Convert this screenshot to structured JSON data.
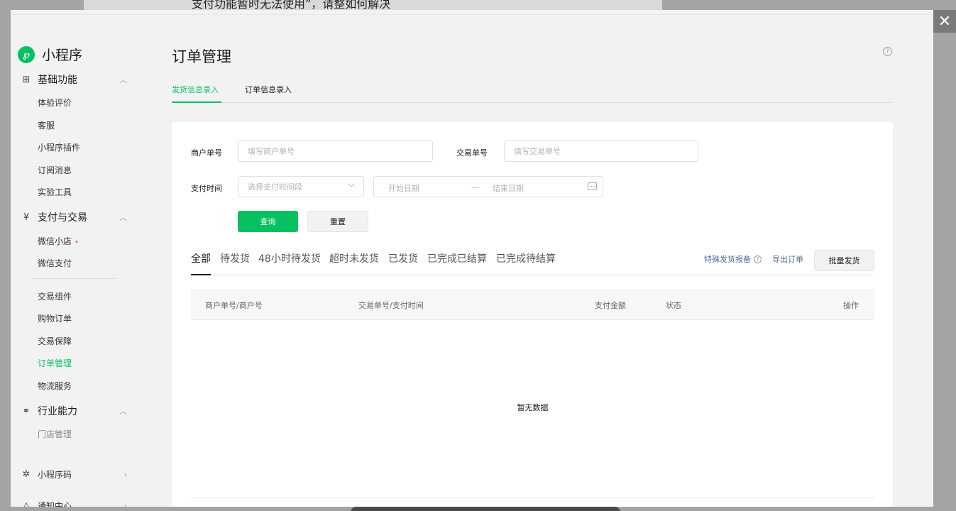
{
  "background": {
    "text": "支付功能暂时无法使用”，请整如何解决"
  },
  "close": {
    "glyph": "✕"
  },
  "brand": {
    "name": "小程序",
    "logo_glyph": "℘",
    "color": "#07c160"
  },
  "sidebar": {
    "groups": [
      {
        "icon": "grid-icon",
        "glyph": "⊞",
        "label": "基础功能",
        "chev": "︿"
      },
      {
        "icon": "yen-icon",
        "glyph": "¥",
        "label": "支付与交易",
        "chev": "︿"
      },
      {
        "icon": "link-icon",
        "glyph": "⚭",
        "label": "行业能力",
        "chev": "︿"
      }
    ],
    "basic_items": [
      "体验评价",
      "客服",
      "小程序插件",
      "订阅消息",
      "实验工具"
    ],
    "pay_items": [
      "微信小店",
      "微信支付"
    ],
    "trade_items": [
      "交易组件",
      "购物订单",
      "交易保障",
      "订单管理",
      "物流服务"
    ],
    "active_item": "订单管理",
    "industry_items": [
      "门店管理"
    ],
    "bottom": [
      {
        "icon": "sparkle-icon",
        "glyph": "✲",
        "label": "小程序码",
        "chev": "›"
      },
      {
        "icon": "bell-icon",
        "glyph": "△",
        "label": "通知中心",
        "chev": "›"
      }
    ]
  },
  "main": {
    "title": "订单管理",
    "help_glyph": "?",
    "tabs": [
      "发货信息录入",
      "订单信息录入"
    ],
    "filters": {
      "merchant_label": "商户单号",
      "merchant_placeholder": "填写商户单号",
      "trade_label": "交易单号",
      "trade_placeholder": "填写交易单号",
      "paytime_label": "支付时间",
      "paytime_select": "选择支付时间段",
      "start_date": "开始日期",
      "range_sep": "—",
      "end_date": "结束日期",
      "query": "查询",
      "reset": "重置"
    },
    "status_tabs": [
      "全部",
      "待发货",
      "48小时待发货",
      "超时未发货",
      "已发货",
      "已完成已结算",
      "已完成待结算"
    ],
    "actions": {
      "special": "特殊发货报备",
      "export": "导出订单",
      "batch": "批量发货"
    },
    "table": {
      "headers": [
        "商户单号/商户号",
        "交易单号/支付时间",
        "支付金额",
        "状态",
        "操作"
      ],
      "empty": "暂无数据"
    }
  }
}
